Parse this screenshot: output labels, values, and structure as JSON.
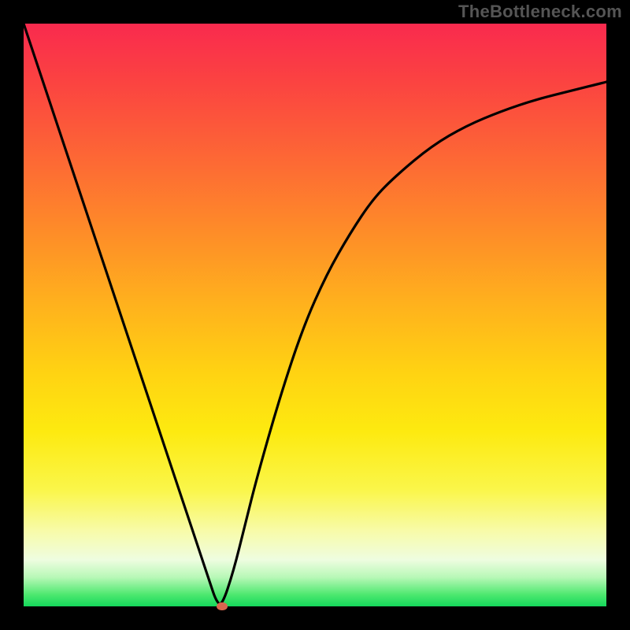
{
  "attribution": "TheBottleneck.com",
  "chart_data": {
    "type": "line",
    "title": "",
    "xlabel": "",
    "ylabel": "",
    "xlim": [
      0,
      100
    ],
    "ylim": [
      0,
      100
    ],
    "grid": false,
    "legend": false,
    "background_gradient": {
      "direction": "vertical",
      "stops": [
        {
          "pos": 0,
          "color": "#f92a4e"
        },
        {
          "pos": 24,
          "color": "#fd6a34"
        },
        {
          "pos": 48,
          "color": "#ffb11d"
        },
        {
          "pos": 70,
          "color": "#fdea10"
        },
        {
          "pos": 87,
          "color": "#f8fba8"
        },
        {
          "pos": 95,
          "color": "#b8f8b7"
        },
        {
          "pos": 100,
          "color": "#14d85b"
        }
      ]
    },
    "series": [
      {
        "name": "curve",
        "color": "#000000",
        "x": [
          0,
          4,
          8,
          12,
          16,
          20,
          24,
          28,
          30,
          32,
          33,
          34,
          36,
          38,
          40,
          44,
          48,
          52,
          56,
          60,
          64,
          70,
          76,
          82,
          88,
          94,
          100
        ],
        "y": [
          100,
          88,
          76,
          64,
          52,
          40,
          28,
          16,
          10,
          4,
          1,
          0,
          6,
          14,
          22,
          36,
          48,
          57,
          64,
          70,
          74,
          79,
          82.5,
          85,
          87,
          88.5,
          90
        ]
      }
    ],
    "marker": {
      "x": 34,
      "y": 0,
      "color": "#d9664f"
    }
  }
}
